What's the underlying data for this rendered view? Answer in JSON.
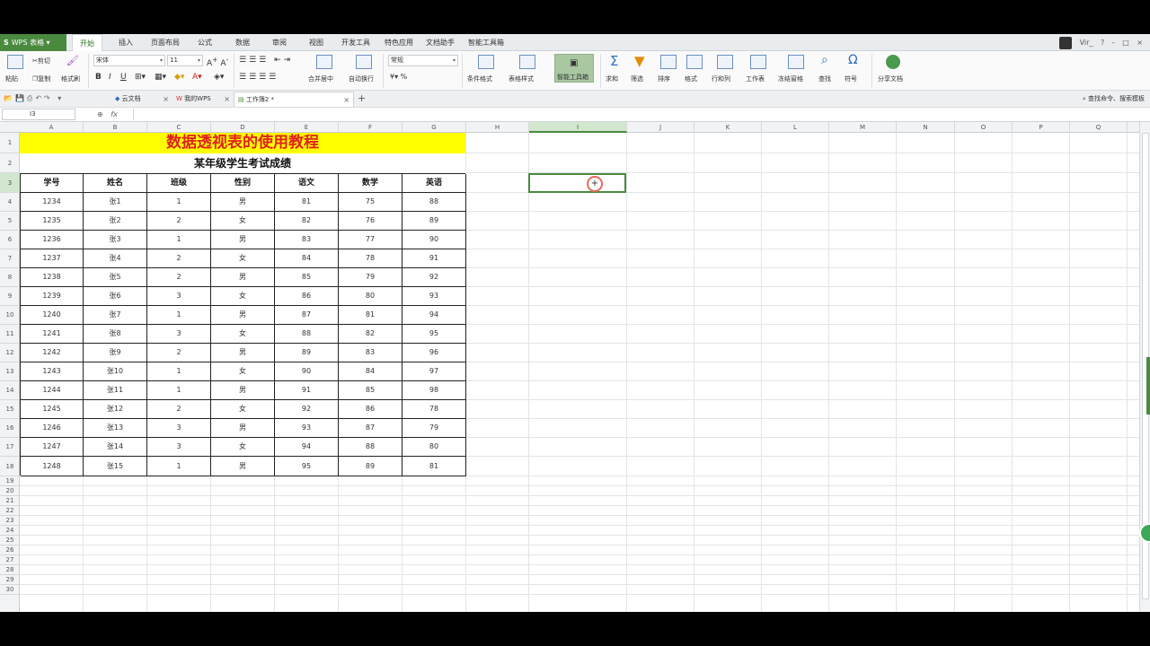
{
  "app": {
    "name": "WPS 表格",
    "s_glyph": "S"
  },
  "menu": {
    "tabs": [
      "开始",
      "插入",
      "页面布局",
      "公式",
      "数据",
      "审阅",
      "视图",
      "开发工具",
      "特色应用",
      "文档助手",
      "智能工具箱"
    ],
    "active_tab": "开始",
    "user": "Vir_",
    "window_controls": [
      "?",
      "-",
      "□",
      "×"
    ]
  },
  "ribbon": {
    "paste": "粘贴",
    "cut": "剪切",
    "copy": "复制",
    "format_painter": "格式刷",
    "font_name": "宋体",
    "font_size": "11",
    "number_format": "常规",
    "merge_center": "合并居中",
    "wrap_text": "自动换行",
    "conditional_format": "条件格式",
    "table_style": "表格样式",
    "smart_toolbox": "智能工具箱",
    "sum": "求和",
    "filter": "筛选",
    "sort": "排序",
    "format": "格式",
    "rows_cols": "行和列",
    "worksheet": "工作表",
    "freeze": "冻结窗格",
    "find": "查找",
    "symbol": "符号",
    "share": "分享文档",
    "bold": "B",
    "italic": "I",
    "underline": "U",
    "percent": "%"
  },
  "doc_tabs": [
    {
      "label": "云文档"
    },
    {
      "label": "我的WPS"
    },
    {
      "label": "工作簿2 *"
    }
  ],
  "search_cmd": "查找命令、搜索模板",
  "formula_bar": {
    "cell_ref": "I3",
    "fx": "fx"
  },
  "columns": [
    "A",
    "B",
    "C",
    "D",
    "E",
    "F",
    "G",
    "H",
    "I",
    "J",
    "K",
    "L",
    "M",
    "N",
    "O",
    "P",
    "Q"
  ],
  "selected_column": "I",
  "selected_row": "3",
  "row_numbers": [
    "1",
    "2",
    "3",
    "4",
    "5",
    "6",
    "7",
    "8",
    "9",
    "10",
    "11",
    "12",
    "13",
    "14",
    "15",
    "16",
    "17",
    "18",
    "19",
    "20",
    "21",
    "22",
    "23",
    "24",
    "25",
    "26",
    "27",
    "28",
    "29",
    "30"
  ],
  "sheet": {
    "title": "数据透视表的使用教程",
    "subtitle": "某年级学生考试成绩",
    "headers": [
      "学号",
      "姓名",
      "班级",
      "性别",
      "语文",
      "数学",
      "英语"
    ],
    "rows": [
      [
        "1234",
        "张1",
        "1",
        "男",
        "81",
        "75",
        "88"
      ],
      [
        "1235",
        "张2",
        "2",
        "女",
        "82",
        "76",
        "89"
      ],
      [
        "1236",
        "张3",
        "1",
        "男",
        "83",
        "77",
        "90"
      ],
      [
        "1237",
        "张4",
        "2",
        "女",
        "84",
        "78",
        "91"
      ],
      [
        "1238",
        "张5",
        "2",
        "男",
        "85",
        "79",
        "92"
      ],
      [
        "1239",
        "张6",
        "3",
        "女",
        "86",
        "80",
        "93"
      ],
      [
        "1240",
        "张7",
        "1",
        "男",
        "87",
        "81",
        "94"
      ],
      [
        "1241",
        "张8",
        "3",
        "女",
        "88",
        "82",
        "95"
      ],
      [
        "1242",
        "张9",
        "2",
        "男",
        "89",
        "83",
        "96"
      ],
      [
        "1243",
        "张10",
        "1",
        "女",
        "90",
        "84",
        "97"
      ],
      [
        "1244",
        "张11",
        "1",
        "男",
        "91",
        "85",
        "98"
      ],
      [
        "1245",
        "张12",
        "2",
        "女",
        "92",
        "86",
        "78"
      ],
      [
        "1246",
        "张13",
        "3",
        "男",
        "93",
        "87",
        "79"
      ],
      [
        "1247",
        "张14",
        "3",
        "女",
        "94",
        "88",
        "80"
      ],
      [
        "1248",
        "张15",
        "1",
        "男",
        "95",
        "89",
        "81"
      ]
    ]
  },
  "colors": {
    "accent": "#4a8a3f",
    "title_bg": "#ffff00",
    "title_text": "#e02020"
  }
}
